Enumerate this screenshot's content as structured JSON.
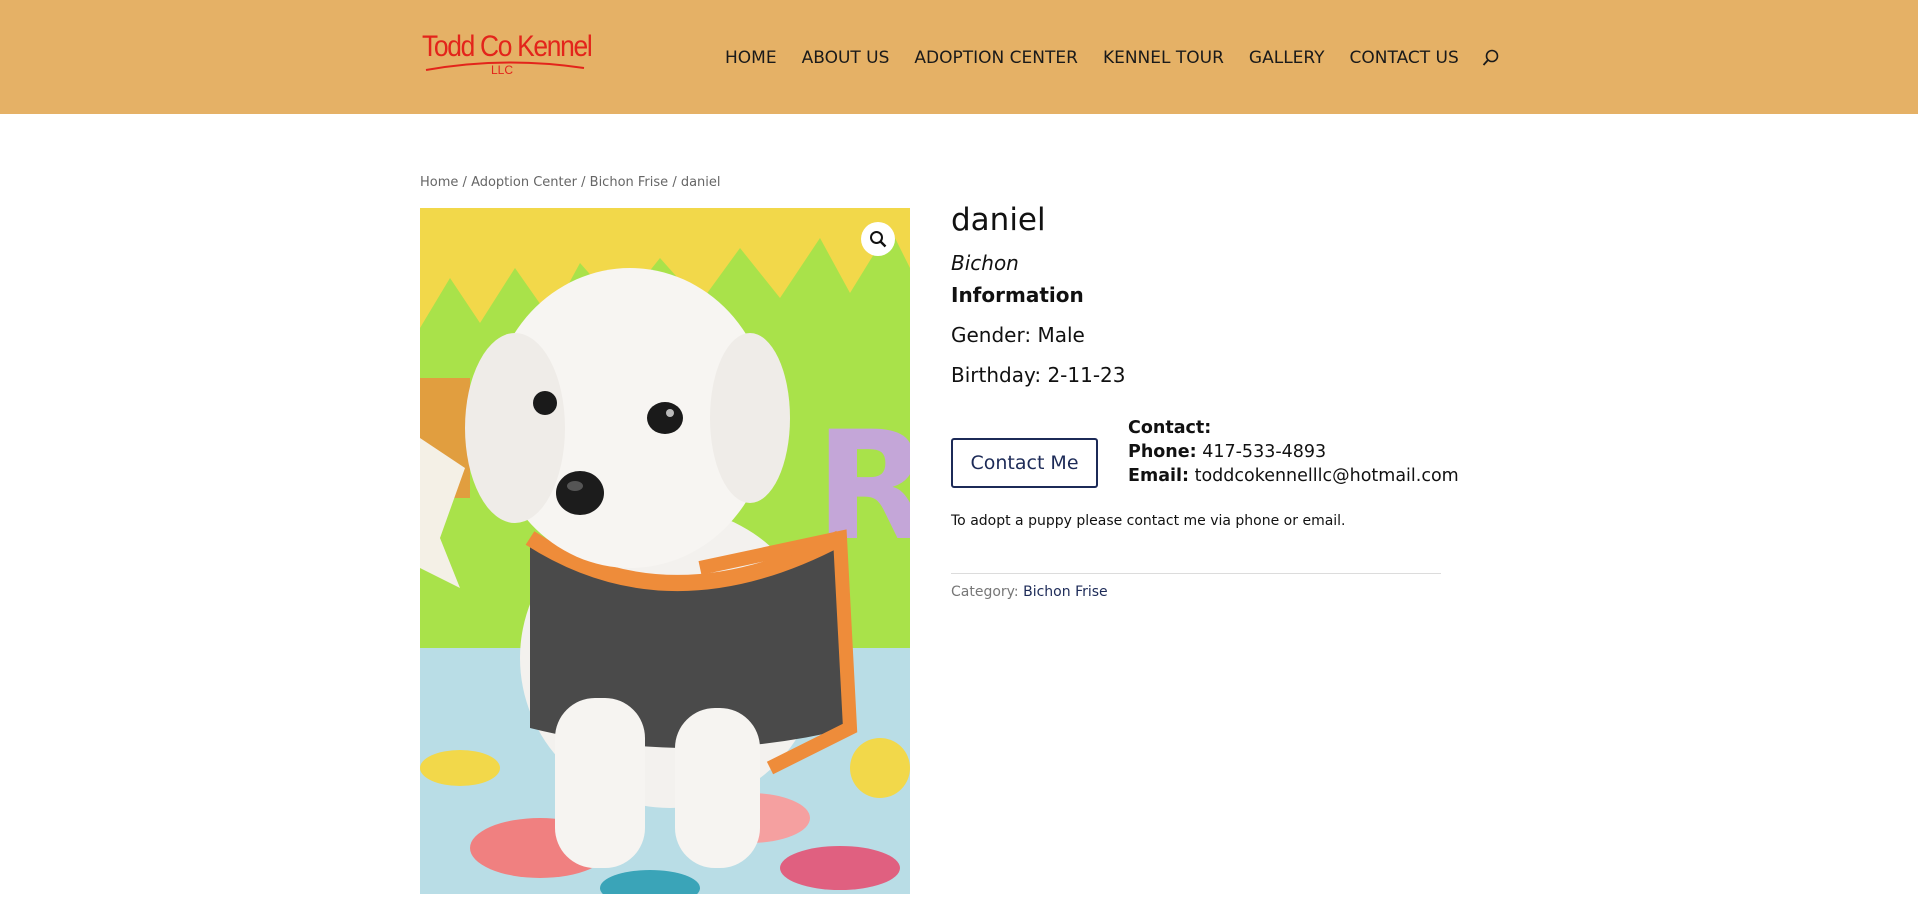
{
  "header": {
    "logo": {
      "main": "Todd Co Kennel",
      "sub": "LLC"
    },
    "nav": [
      "HOME",
      "ABOUT US",
      "ADOPTION CENTER",
      "KENNEL TOUR",
      "GALLERY",
      "CONTACT US"
    ],
    "search_icon": "search-icon",
    "background": "#e5b166"
  },
  "breadcrumb": {
    "items": [
      "Home",
      "Adoption Center",
      "Bichon Frise"
    ],
    "current": "daniel",
    "separator": "/"
  },
  "product": {
    "title": "daniel",
    "breed": "Bichon",
    "info_heading": "Information",
    "gender": "Gender: Male",
    "birthday": "Birthday: 2-11-23",
    "contact_button": "Contact Me",
    "contact": {
      "heading": "Contact:",
      "phone_label": "Phone:",
      "phone": "417-533-4893",
      "email_label": "Email:",
      "email": "toddcokennelllc@hotmail.com"
    },
    "note": "To adopt a puppy please contact me via phone or email.",
    "category_label": "Category:",
    "category": "Bichon Frise",
    "zoom_icon": "magnifier-icon"
  },
  "colors": {
    "accent": "#1c2a57",
    "logo_red": "#e3241b"
  }
}
